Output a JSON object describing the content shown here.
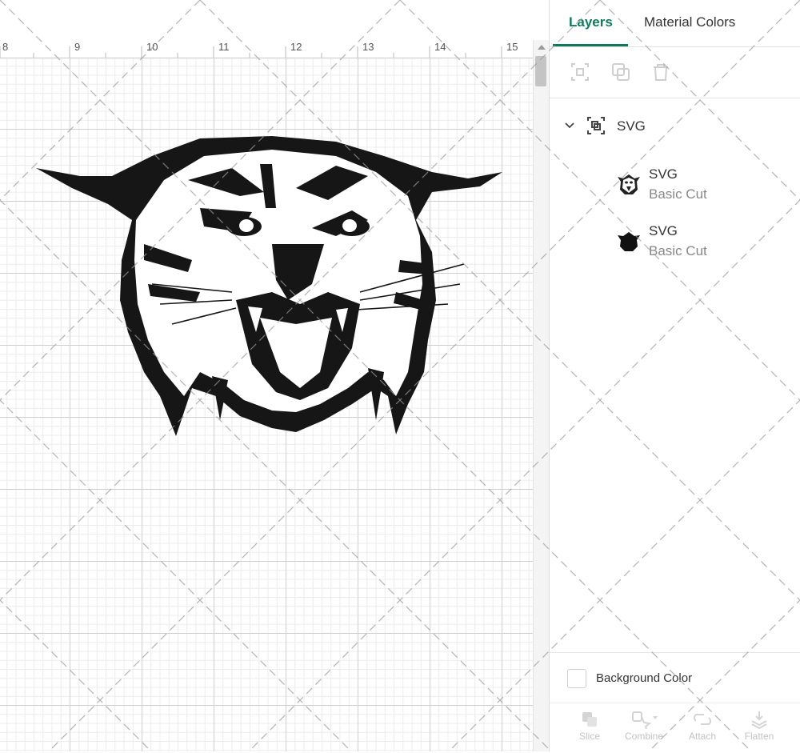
{
  "ruler": {
    "ticks": [
      "8",
      "9",
      "10",
      "11",
      "12",
      "13",
      "14",
      "15"
    ]
  },
  "tabs": [
    {
      "label": "Layers"
    },
    {
      "label": "Material Colors"
    }
  ],
  "toolbar": {
    "icons": [
      "group-icon",
      "duplicate-icon",
      "delete-icon"
    ]
  },
  "layers": {
    "group": {
      "title": "SVG"
    },
    "items": [
      {
        "title": "SVG",
        "subtitle": "Basic Cut"
      },
      {
        "title": "SVG",
        "subtitle": "Basic Cut"
      }
    ]
  },
  "background_color": {
    "label": "Background Color"
  },
  "bottom_toolbar": [
    {
      "label": "Slice",
      "icon": "slice-icon"
    },
    {
      "label": "Combine",
      "icon": "combine-icon"
    },
    {
      "label": "Attach",
      "icon": "attach-icon"
    },
    {
      "label": "Flatten",
      "icon": "flatten-icon"
    }
  ],
  "colors": {
    "accent": "#0f7b5d",
    "disabled": "#c2c2c2"
  }
}
